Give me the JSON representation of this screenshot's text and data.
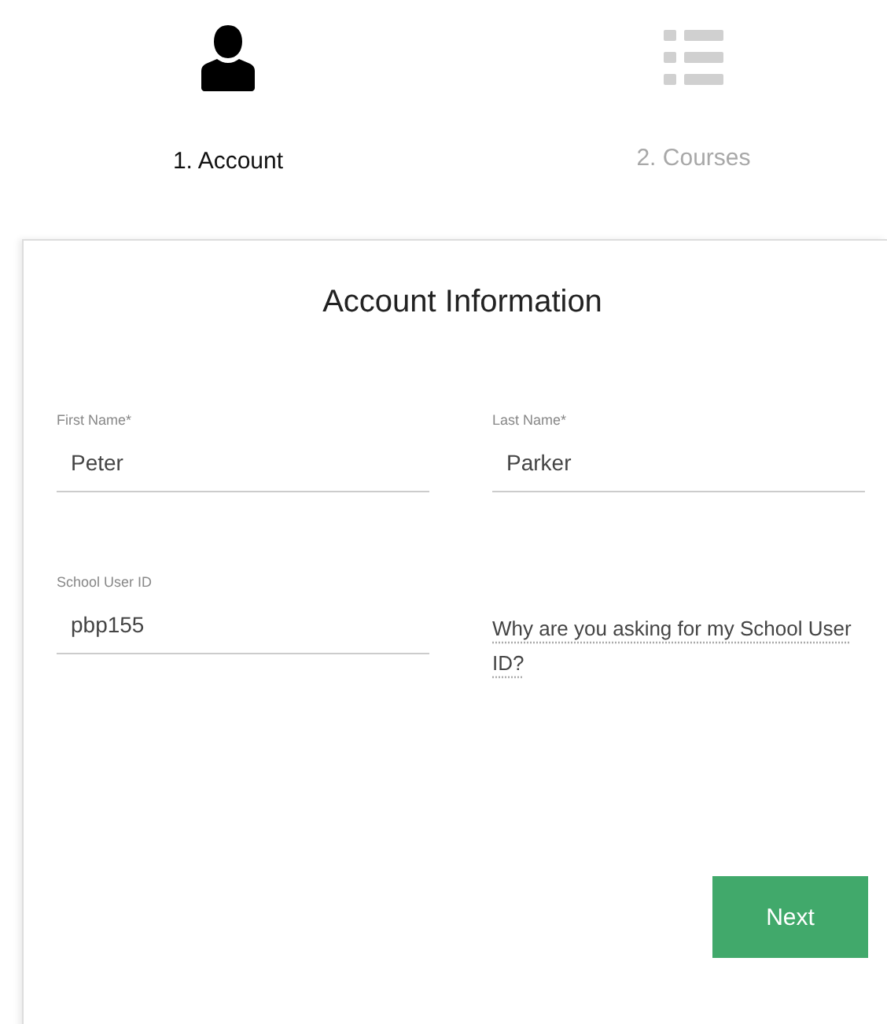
{
  "steps": [
    {
      "label": "1. Account",
      "kind": "person",
      "selected": true
    },
    {
      "label": "2. Courses",
      "kind": "list",
      "selected": false
    }
  ],
  "form": {
    "title": "Account Information",
    "fields": [
      {
        "label": "First Name*",
        "value": "Peter"
      },
      {
        "label": "Last Name*",
        "value": "Parker"
      },
      {
        "label": "School User ID",
        "value": "pbp155"
      }
    ],
    "help_link": "Why are you asking for my School User ID?",
    "button": "Next"
  }
}
